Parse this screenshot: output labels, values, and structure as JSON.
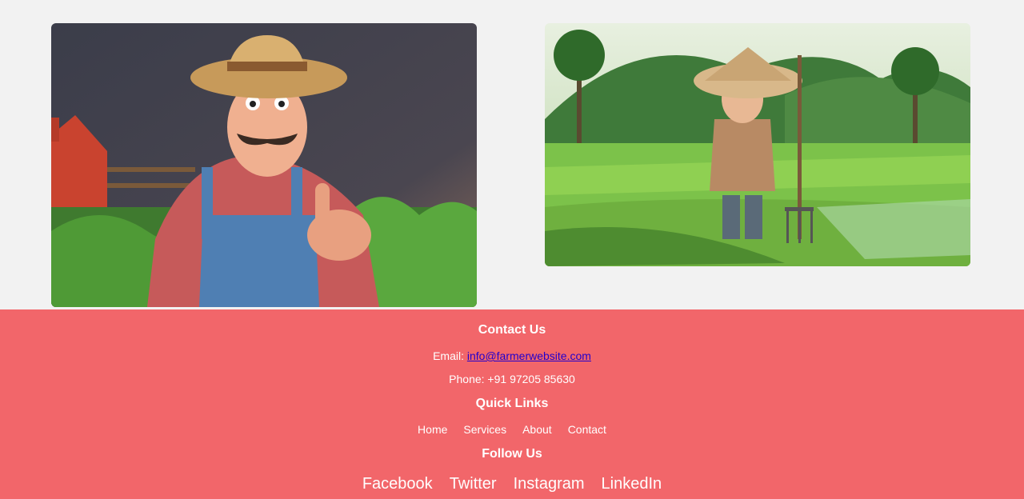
{
  "gallery": {
    "images": [
      {
        "alt": "cartoon-farmer-thumbs-up"
      },
      {
        "alt": "cartoon-rice-farmer-boy"
      }
    ]
  },
  "footer": {
    "contact": {
      "heading": "Contact Us",
      "email_label": "Email: ",
      "email": "info@farmerwebsite.com",
      "phone": "Phone: +91 97205 85630"
    },
    "quick_links": {
      "heading": "Quick Links",
      "items": [
        "Home",
        "Services",
        "About",
        "Contact"
      ]
    },
    "follow": {
      "heading": "Follow Us",
      "items": [
        "Facebook",
        "Twitter",
        "Instagram",
        "LinkedIn"
      ]
    }
  },
  "colors": {
    "footer_bg": "#f2666a",
    "page_bg": "#f2f2f2",
    "link": "#2200cc"
  }
}
